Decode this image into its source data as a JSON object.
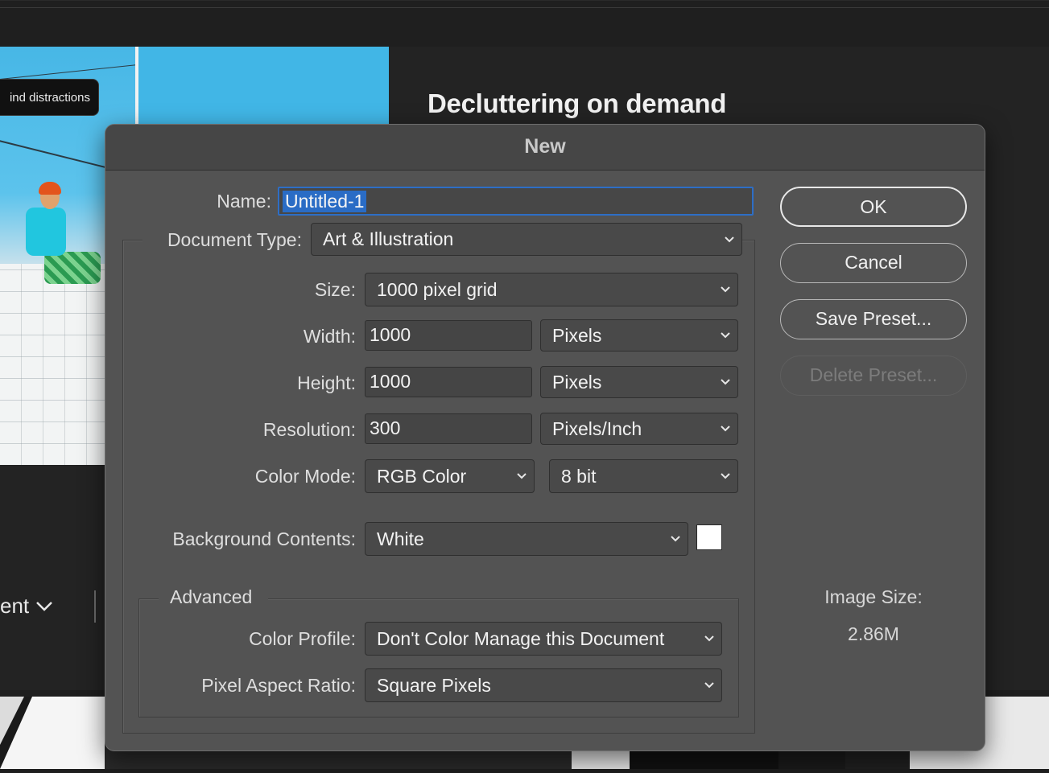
{
  "background": {
    "tooltip_text": "ind distractions",
    "heading": "Decluttering on demand",
    "menu_text": "ent"
  },
  "dialog": {
    "title": "New",
    "name_label": "Name:",
    "name_value": "Untitled-1",
    "document_type_label": "Document Type:",
    "document_type_value": "Art & Illustration",
    "size_label": "Size:",
    "size_value": "1000 pixel grid",
    "width_label": "Width:",
    "width_value": "1000",
    "width_unit": "Pixels",
    "height_label": "Height:",
    "height_value": "1000",
    "height_unit": "Pixels",
    "resolution_label": "Resolution:",
    "resolution_value": "300",
    "resolution_unit": "Pixels/Inch",
    "color_mode_label": "Color Mode:",
    "color_mode_value": "RGB Color",
    "bit_depth_value": "8 bit",
    "background_label": "Background Contents:",
    "background_value": "White",
    "background_swatch_color": "#ffffff",
    "advanced_label": "Advanced",
    "color_profile_label": "Color Profile:",
    "color_profile_value": "Don't Color Manage this Document",
    "pixel_aspect_label": "Pixel Aspect Ratio:",
    "pixel_aspect_value": "Square Pixels"
  },
  "buttons": {
    "ok": "OK",
    "cancel": "Cancel",
    "save_preset": "Save Preset...",
    "delete_preset": "Delete Preset..."
  },
  "image_size": {
    "label": "Image Size:",
    "value": "2.86M"
  },
  "colors": {
    "accent": "#2a6cc5",
    "dialog_bg": "#535353"
  }
}
